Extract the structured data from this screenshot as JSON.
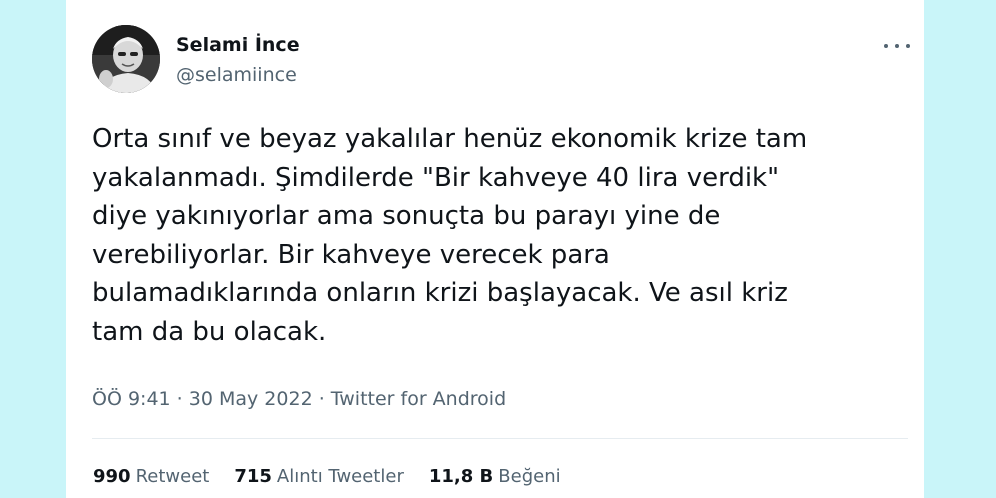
{
  "author": {
    "name": "Selami İnce",
    "handle": "@selamiince"
  },
  "tweet": {
    "text": "Orta sınıf ve beyaz yakalılar henüz ekonomik krize tam\nyakalanmadı. Şimdilerde \"Bir kahveye 40 lira verdik\"\ndiye yakınıyorlar ama sonuçta bu parayı yine de\nverebiliyorlar. Bir kahveye  verecek para\nbulamadıklarında onların krizi başlayacak. Ve asıl kriz\ntam da bu olacak.",
    "time": "ÖÖ 9:41",
    "date": "30 May 2022",
    "source": "Twitter for Android",
    "separator": "·"
  },
  "stats": {
    "retweets": {
      "value": "990",
      "label": "Retweet"
    },
    "quotes": {
      "value": "715",
      "label": "Alıntı Tweetler"
    },
    "likes": {
      "value": "11,8 B",
      "label": "Beğeni"
    }
  },
  "icons": {
    "more": "more-horizontal-icon"
  },
  "colors": {
    "background": "#c9f5f9",
    "card": "#ffffff",
    "text": "#0f1419",
    "secondary": "#536471",
    "divider": "#e6ecf0"
  }
}
